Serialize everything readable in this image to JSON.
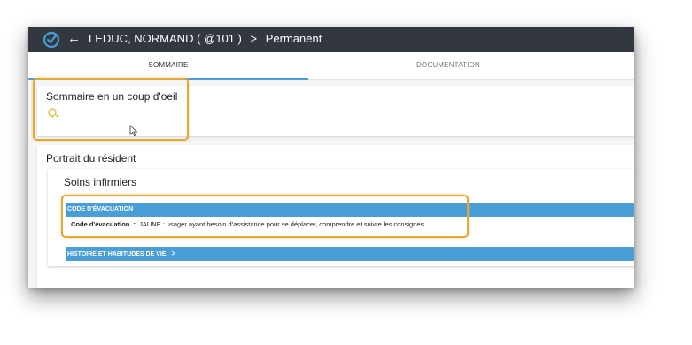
{
  "header": {
    "back_icon": "arrow-left-icon",
    "name": "LEDUC, NORMAND",
    "id": "( @101 )",
    "chevron": ">",
    "status": "Permanent"
  },
  "tabs": [
    {
      "label": "SOMMAIRE",
      "active": true
    },
    {
      "label": "DOCUMENTATION",
      "active": false
    }
  ],
  "sommaire": {
    "title": "Sommaire en un coup d'oeil",
    "icon": "lightbulb-icon"
  },
  "portrait": {
    "title": "Portrait du résident",
    "section": {
      "title": "Soins infirmiers",
      "evacuation": {
        "header": "CODE D'ÉVACUATION",
        "label": "Code d'évacuation",
        "colon": ":",
        "value": "JAUNE : usager ayant besoin d'assistance pour se déplacer, comprendre et suivre les consignes"
      },
      "histoire": {
        "header": "HISTOIRE ET HABITUDES DE VIE",
        "chevron": ">"
      }
    }
  },
  "colors": {
    "topbar": "#33373f",
    "accent": "#4a9ed8",
    "highlight": "#e1a83b"
  }
}
